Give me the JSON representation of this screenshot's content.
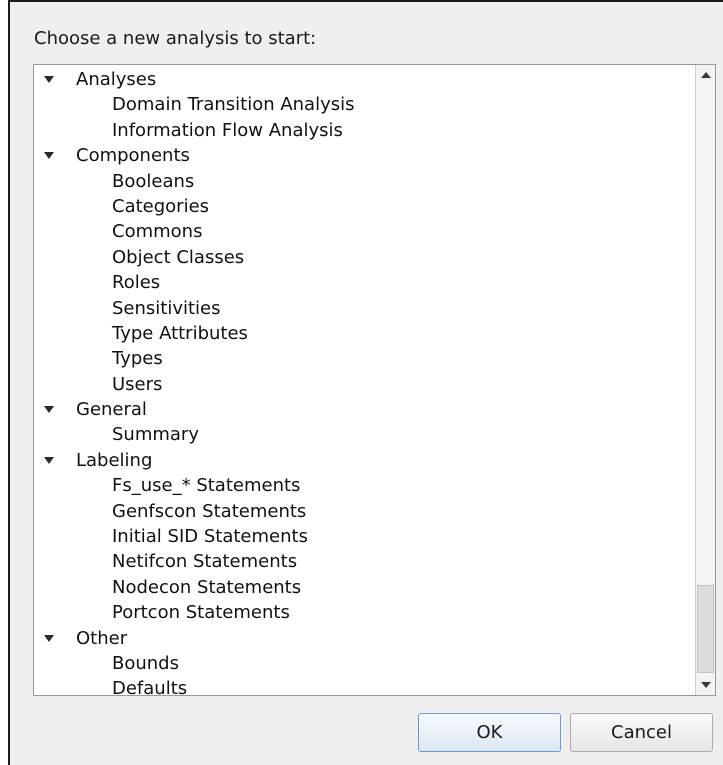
{
  "prompt": "Choose a new analysis to start:",
  "tree": [
    {
      "label": "Analyses",
      "children": [
        "Domain Transition Analysis",
        "Information Flow Analysis"
      ]
    },
    {
      "label": "Components",
      "children": [
        "Booleans",
        "Categories",
        "Commons",
        "Object Classes",
        "Roles",
        "Sensitivities",
        "Type Attributes",
        "Types",
        "Users"
      ]
    },
    {
      "label": "General",
      "children": [
        "Summary"
      ]
    },
    {
      "label": "Labeling",
      "children": [
        "Fs_use_* Statements",
        "Genfscon Statements",
        "Initial SID Statements",
        "Netifcon Statements",
        "Nodecon Statements",
        "Portcon Statements"
      ]
    },
    {
      "label": "Other",
      "children": [
        "Bounds",
        "Defaults"
      ]
    }
  ],
  "buttons": {
    "ok": "OK",
    "cancel": "Cancel"
  }
}
